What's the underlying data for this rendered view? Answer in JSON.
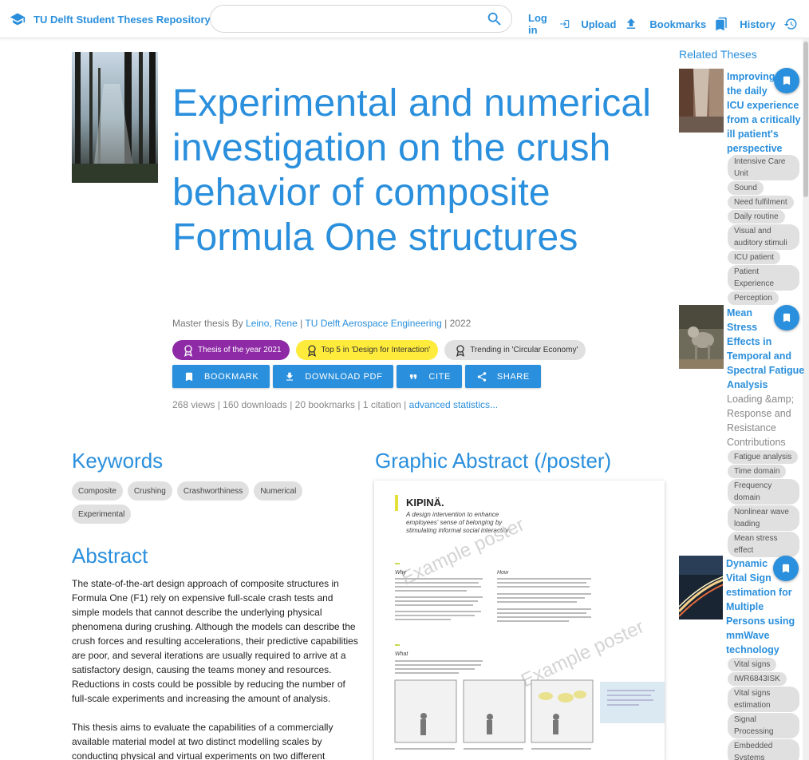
{
  "header": {
    "brand": "TU Delft Student Theses Repository",
    "search_placeholder": "",
    "nav": [
      "Log in",
      "Upload",
      "Bookmarks",
      "History"
    ]
  },
  "thesis": {
    "title": "Experimental and numerical investigation on the crush behavior of composite Formula One structures",
    "byline_prefix": "Master thesis By",
    "author": "Leino, Rene",
    "sep1": "|",
    "faculty": "TU Delft Aerospace Engineering",
    "sep2": "|",
    "year": "2022",
    "awards": [
      "Thesis of the year 2021",
      "Top 5 in 'Design for Interaction'",
      "Trending in 'Circular Economy'"
    ],
    "actions": [
      "BOOKMARK",
      "DOWNLOAD PDF",
      "CITE",
      "SHARE"
    ],
    "stats": "268 views | 160 downloads | 20 bookmarks | 1 citation |",
    "stats_link": "advanced statistics..."
  },
  "keywords": {
    "heading": "Keywords",
    "items": [
      "Composite",
      "Crushing",
      "Crashworthiness",
      "Numerical",
      "Experimental"
    ]
  },
  "abstract": {
    "heading": "Abstract",
    "paragraphs": [
      "The state-of-the-art design approach of composite structures in Formula One (F1) rely on expensive full-scale crash tests and simple models that cannot describe the underlying physical phenomena during crushing. Although the models can describe the crush forces and resulting accelerations, their predictive capabilities are poor, and several iterations are usually required to arrive at a satisfactory design, causing the teams money and resources. Reductions in costs could be possible by reducing the number of full-scale experiments and increasing the amount of analysis.",
      "This thesis aims to evaluate the capabilities of a commercially available material model at two distinct modelling scales by conducting physical and virtual experiments on two different"
    ]
  },
  "graphic_abstract": {
    "heading": "Graphic Abstract (/poster)",
    "poster_title": "KIPINÄ.",
    "poster_subtitle": "A design intervention to enhance employees' sense of belonging by stimulating informal social interaction.",
    "watermark": "Example poster",
    "why": "Why",
    "how": "How",
    "what": "What"
  },
  "related": {
    "heading": "Related Theses",
    "items": [
      {
        "title_lines": [
          "Improving",
          "the daily",
          "ICU experience",
          "from a critically",
          "ill patient's",
          "perspective"
        ],
        "subtitle_lines": [],
        "tags": [
          "Intensive Care Unit",
          "Sound",
          "Need fulfilment",
          "Daily routine",
          "Visual and auditory stimuli",
          "ICU patient",
          "Patient Experience",
          "Perception"
        ]
      },
      {
        "title_lines": [
          "Mean",
          "Stress",
          "Effects in",
          "Temporal and",
          "Spectral Fatigue",
          "Analysis"
        ],
        "subtitle_lines": [
          "Loading &amp;",
          "Response and",
          "Resistance",
          "Contributions"
        ],
        "tags": [
          "Fatigue analysis",
          "Time domain",
          "Frequency domain",
          "Nonlinear wave loading",
          "Mean stress effect"
        ]
      },
      {
        "title_lines": [
          "Dynamic",
          "Vital Sign",
          "estimation for",
          "Multiple",
          "Persons using",
          "mmWave",
          "technology"
        ],
        "subtitle_lines": [],
        "tags": [
          "Vital signs",
          "IWR6843ISK",
          "Vital signs estimation",
          "Signal Processing",
          "Embedded Systems"
        ]
      }
    ]
  },
  "colors": {
    "accent": "#2a8fdc",
    "purple": "#8e2aa5",
    "yellow": "#ffeb3b",
    "chip": "#e0e0e0"
  },
  "icons": [
    "graduation-cap-icon",
    "search-icon",
    "login-icon",
    "upload-icon",
    "bookmark-icon",
    "history-icon",
    "award-icon",
    "download-icon",
    "quote-icon",
    "share-icon"
  ]
}
